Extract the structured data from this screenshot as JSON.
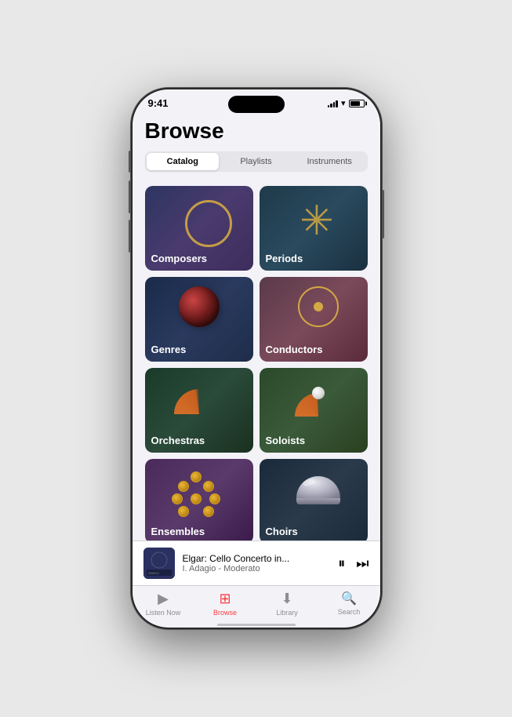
{
  "status": {
    "time": "9:41"
  },
  "header": {
    "title": "Browse"
  },
  "tabs": [
    {
      "id": "catalog",
      "label": "Catalog",
      "active": true
    },
    {
      "id": "playlists",
      "label": "Playlists",
      "active": false
    },
    {
      "id": "instruments",
      "label": "Instruments",
      "active": false
    }
  ],
  "grid": {
    "items": [
      {
        "id": "composers",
        "label": "Composers",
        "color_start": "#2d3561",
        "color_end": "#4a3a6e"
      },
      {
        "id": "periods",
        "label": "Periods",
        "color_start": "#1e3a4a",
        "color_end": "#2a4a5e"
      },
      {
        "id": "genres",
        "label": "Genres",
        "color_start": "#1a2a4a",
        "color_end": "#2a3a5e"
      },
      {
        "id": "conductors",
        "label": "Conductors",
        "color_start": "#5a3a4a",
        "color_end": "#7a4a5a"
      },
      {
        "id": "orchestras",
        "label": "Orchestras",
        "color_start": "#1a3a2a",
        "color_end": "#2a4a3a"
      },
      {
        "id": "soloists",
        "label": "Soloists",
        "color_start": "#2a4a2a",
        "color_end": "#3a5a3a"
      },
      {
        "id": "ensembles",
        "label": "Ensembles",
        "color_start": "#4a2a5a",
        "color_end": "#5a3a6a"
      },
      {
        "id": "choirs",
        "label": "Choirs",
        "color_start": "#1a2a3a",
        "color_end": "#2a3a4a"
      }
    ]
  },
  "mini_player": {
    "title": "Elgar: Cello Concerto in...",
    "subtitle": "I. Adagio - Moderato",
    "play_pause_icon": "⏸",
    "skip_icon": "⏭"
  },
  "tab_nav": [
    {
      "id": "listen-now",
      "label": "Listen Now",
      "icon": "▶",
      "active": false
    },
    {
      "id": "browse",
      "label": "Browse",
      "icon": "⊞",
      "active": true
    },
    {
      "id": "library",
      "label": "Library",
      "icon": "⬇",
      "active": false
    },
    {
      "id": "search",
      "label": "Search",
      "icon": "🔍",
      "active": false
    }
  ]
}
